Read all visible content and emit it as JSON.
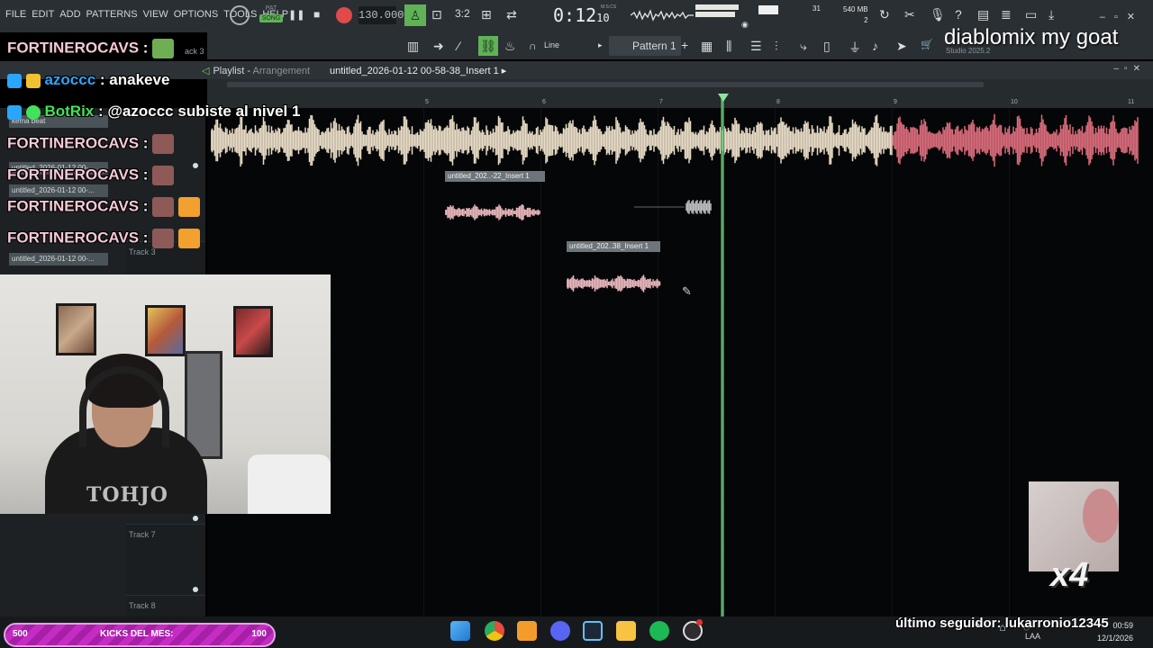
{
  "menu": [
    "FILE",
    "EDIT",
    "ADD",
    "PATTERNS",
    "VIEW",
    "OPTIONS",
    "TOOLS",
    "HELP"
  ],
  "transport": {
    "pat_label": "PAT",
    "song_label": "SONG",
    "tempo": "130.000",
    "time_main": "0:12",
    "time_sub": "10",
    "time_unit": "M:S:CS"
  },
  "meters": {
    "cpu": "31",
    "memory": "540 MB",
    "voices": "2"
  },
  "toolbar2": {
    "snap": "Line",
    "pattern": "Pattern 1",
    "studio_version": "Studio 2025.2"
  },
  "playlist": {
    "title": "Playlist",
    "subtitle": "Arrangement",
    "file": "untitled_2026-01-12 00-58-38_Insert 1",
    "bars": [
      "5",
      "6",
      "7",
      "8",
      "9",
      "10",
      "11"
    ],
    "clips": [
      {
        "label": "untitled_202..-22_Insert 1"
      },
      {
        "label": "untitled_202..38_Insert 1"
      }
    ],
    "tracks": [
      {
        "label": "Track 3"
      },
      {
        "label": "Track 7"
      },
      {
        "label": "Track 8"
      }
    ],
    "left_clips": [
      "kema beat",
      "untitled_2026-01-12 00-...",
      "untitled_2026-01-12 00-...",
      "untitled_2026-01-12 00-..."
    ],
    "left_clip_0_prefix": "ack 3"
  },
  "chat": [
    {
      "user": "FORTINEROCAVS",
      "sep": " : ",
      "msg": ""
    },
    {
      "user": "azoccc",
      "sep": " : ",
      "msg": "anakeve"
    },
    {
      "user": "BotRix",
      "sep": " : ",
      "msg": "@azoccc subiste al nivel 1"
    },
    {
      "user": "FORTINEROCAVS",
      "sep": " : ",
      "msg": ""
    },
    {
      "user": "FORTINEROCAVS",
      "sep": " : ",
      "msg": ""
    },
    {
      "user": "FORTINEROCAVS",
      "sep": " : ",
      "msg": ""
    },
    {
      "user": "FORTINEROCAVS",
      "sep": " : ",
      "msg": ""
    }
  ],
  "overlay": {
    "goat": "diablomix my goat",
    "multiplier": "x4",
    "follower": "último seguidor: lukarronio12345",
    "shirt": "TOHJO"
  },
  "kicks": {
    "left": "500",
    "label": "KICKS DEL MES:",
    "right": "100"
  },
  "taskbar": {
    "lang": "LAA",
    "time": "00:59",
    "date": "12/1/2026"
  },
  "colors": {
    "waveform_main": "#e8dcc6",
    "waveform_red": "#d86b7a",
    "playhead": "#7ee08a",
    "chat_name": "#f5c8d6"
  }
}
